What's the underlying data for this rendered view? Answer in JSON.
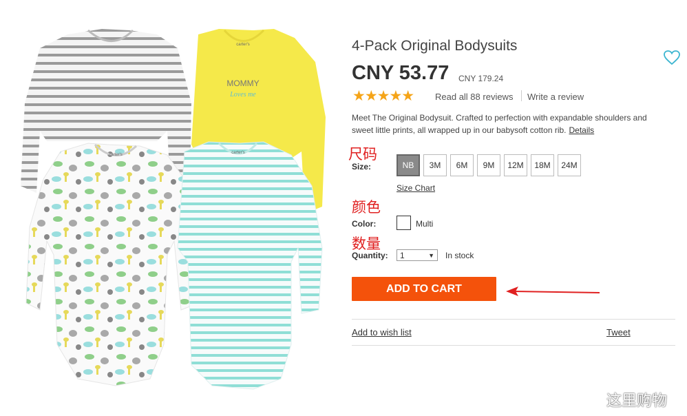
{
  "product": {
    "title": "4-Pack Original Bodysuits",
    "price": "CNY 53.77",
    "old_price": "CNY 179.24",
    "rating": "★★★★★",
    "reviews_link": "Read all 88 reviews",
    "write_review": "Write a review",
    "description": "Meet The Original Bodysuit. Crafted to perfection with expandable shoulders and sweet little prints, all wrapped up in our babysoft cotton rib.",
    "details_link": "Details",
    "image_text": {
      "mommy": "MOMMY",
      "loves_me": "Loves me",
      "tag": "carter's"
    }
  },
  "size": {
    "label": "Size:",
    "options": [
      "NB",
      "3M",
      "6M",
      "9M",
      "12M",
      "18M",
      "24M"
    ],
    "selected": "NB",
    "chart_link": "Size Chart"
  },
  "color": {
    "label": "Color:",
    "value": "Multi"
  },
  "quantity": {
    "label": "Quantity:",
    "value": "1",
    "stock": "In stock"
  },
  "actions": {
    "add_to_cart": "ADD TO CART",
    "wish_list": "Add to wish list",
    "tweet": "Tweet"
  },
  "annotations": {
    "size": "尺码",
    "color": "颜色",
    "quantity": "数量"
  },
  "watermark": "这里购物",
  "colors": {
    "accent": "#f4520b",
    "stars": "#f5a418",
    "annotation": "#e02020",
    "heart": "#3bb5d0"
  }
}
